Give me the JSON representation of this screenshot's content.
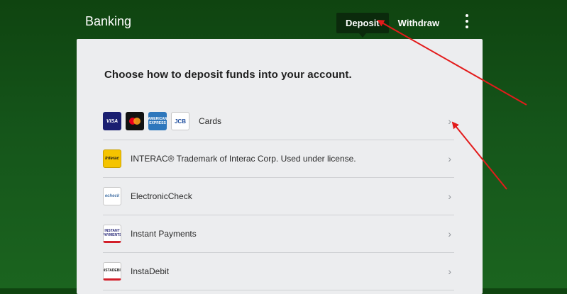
{
  "header": {
    "title": "Banking",
    "tabs": [
      {
        "label": "Deposit",
        "active": true
      },
      {
        "label": "Withdraw",
        "active": false
      }
    ],
    "menu_icon": "more-vertical-icon"
  },
  "panel": {
    "heading": "Choose how to deposit funds into your account.",
    "methods": [
      {
        "label": "Cards",
        "logos": [
          "VISA",
          "mastercard",
          "AMERICAN EXPRESS",
          "JCB"
        ]
      },
      {
        "label": "INTERAC® Trademark of Interac Corp. Used under license.",
        "logo": "Interac"
      },
      {
        "label": "ElectronicCheck",
        "logo": "echeck"
      },
      {
        "label": "Instant Payments",
        "logo": "INSTANT PAYMENTS"
      },
      {
        "label": "InstaDebit",
        "logo": "INSTADEBIT"
      }
    ],
    "chevron": "›"
  },
  "colors": {
    "background": "#15551a",
    "active_tab": "#0b2a0c",
    "panel": "#ecedef",
    "annotation": "#e31b1b"
  }
}
